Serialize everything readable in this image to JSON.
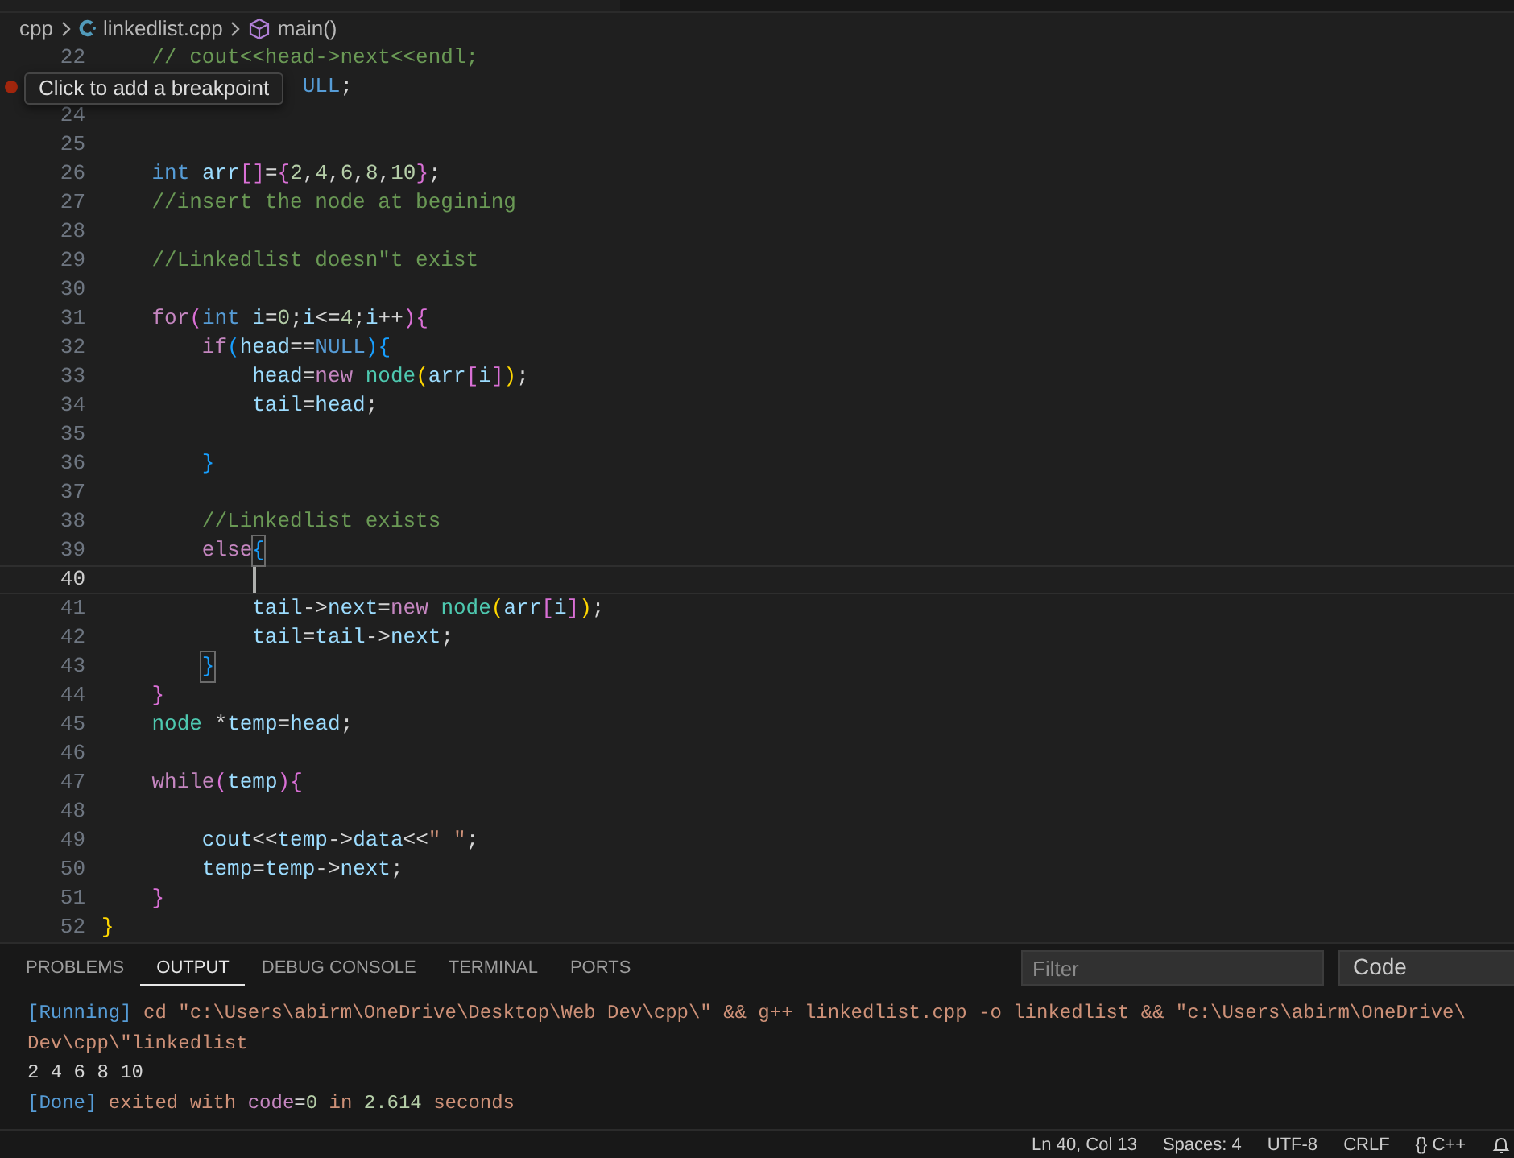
{
  "breadcrumb": {
    "folder": "cpp",
    "file": "linkedlist.cpp",
    "symbol": "main()"
  },
  "editor": {
    "tooltip": "Click to add a breakpoint",
    "lines": [
      {
        "number": "22",
        "current": false,
        "tokens": [
          {
            "text": "    // cout<<head->next<<endl;",
            "kind": "c"
          }
        ]
      },
      {
        "current": false,
        "breakpoint_hint": true,
        "tokens": [
          {
            "text": "                ULL",
            "kind": "m"
          },
          {
            "text": ";",
            "kind": "p"
          }
        ]
      },
      {
        "number": "24",
        "current": false
      },
      {
        "number": "25",
        "current": false
      },
      {
        "number": "26",
        "current": false,
        "tokens": [
          {
            "text": "    int",
            "kind": "t"
          },
          {
            "text": " arr",
            "kind": "v"
          },
          {
            "text": "[]",
            "kind": "b2"
          },
          {
            "text": "=",
            "kind": "p"
          },
          {
            "text": "{",
            "kind": "b2"
          },
          {
            "text": "2",
            "kind": "n"
          },
          {
            "text": ",",
            "kind": "p"
          },
          {
            "text": "4",
            "kind": "n"
          },
          {
            "text": ",",
            "kind": "p"
          },
          {
            "text": "6",
            "kind": "n"
          },
          {
            "text": ",",
            "kind": "p"
          },
          {
            "text": "8",
            "kind": "n"
          },
          {
            "text": ",",
            "kind": "p"
          },
          {
            "text": "10",
            "kind": "n"
          },
          {
            "text": "}",
            "kind": "b2"
          },
          {
            "text": ";",
            "kind": "p"
          }
        ]
      },
      {
        "number": "27",
        "current": false,
        "tokens": [
          {
            "text": "    //insert the node at begining",
            "kind": "c"
          }
        ]
      },
      {
        "number": "28",
        "current": false
      },
      {
        "number": "29",
        "current": false,
        "tokens": [
          {
            "text": "    //Linkedlist doesn\"t exist",
            "kind": "c"
          }
        ]
      },
      {
        "number": "30",
        "current": false
      },
      {
        "number": "31",
        "current": false,
        "tokens": [
          {
            "text": "    for",
            "kind": "k"
          },
          {
            "text": "(",
            "kind": "b2"
          },
          {
            "text": "int",
            "kind": "t"
          },
          {
            "text": " i",
            "kind": "v"
          },
          {
            "text": "=",
            "kind": "p"
          },
          {
            "text": "0",
            "kind": "n"
          },
          {
            "text": ";",
            "kind": "p"
          },
          {
            "text": "i",
            "kind": "v"
          },
          {
            "text": "<=",
            "kind": "p"
          },
          {
            "text": "4",
            "kind": "n"
          },
          {
            "text": ";",
            "kind": "p"
          },
          {
            "text": "i",
            "kind": "v"
          },
          {
            "text": "++",
            "kind": "p"
          },
          {
            "text": "){",
            "kind": "b2"
          }
        ]
      },
      {
        "number": "32",
        "current": false,
        "tokens": [
          {
            "text": "        if",
            "kind": "k"
          },
          {
            "text": "(",
            "kind": "b3"
          },
          {
            "text": "head",
            "kind": "v"
          },
          {
            "text": "==",
            "kind": "p"
          },
          {
            "text": "NULL",
            "kind": "m"
          },
          {
            "text": "){",
            "kind": "b3"
          }
        ]
      },
      {
        "number": "33",
        "current": false,
        "tokens": [
          {
            "text": "            head",
            "kind": "v"
          },
          {
            "text": "=",
            "kind": "p"
          },
          {
            "text": "new",
            "kind": "k"
          },
          {
            "text": " node",
            "kind": "f"
          },
          {
            "text": "(",
            "kind": "b1"
          },
          {
            "text": "arr",
            "kind": "v"
          },
          {
            "text": "[",
            "kind": "b2"
          },
          {
            "text": "i",
            "kind": "v"
          },
          {
            "text": "]",
            "kind": "b2"
          },
          {
            "text": ")",
            "kind": "b1"
          },
          {
            "text": ";",
            "kind": "p"
          }
        ]
      },
      {
        "number": "34",
        "current": false,
        "tokens": [
          {
            "text": "            tail",
            "kind": "v"
          },
          {
            "text": "=",
            "kind": "p"
          },
          {
            "text": "head",
            "kind": "v"
          },
          {
            "text": ";",
            "kind": "p"
          }
        ]
      },
      {
        "number": "35",
        "current": false
      },
      {
        "number": "36",
        "current": false,
        "tokens": [
          {
            "text": "        }",
            "kind": "b3"
          }
        ]
      },
      {
        "number": "37",
        "current": false
      },
      {
        "number": "38",
        "current": false,
        "tokens": [
          {
            "text": "        //Linkedlist exists",
            "kind": "c"
          }
        ]
      },
      {
        "number": "39",
        "current": false,
        "tokens": [
          {
            "text": "        else",
            "kind": "k"
          },
          {
            "text": "{",
            "kind": "b3",
            "matched": true
          }
        ]
      },
      {
        "number": "40",
        "current": true
      },
      {
        "number": "41",
        "current": false,
        "tokens": [
          {
            "text": "            tail",
            "kind": "v"
          },
          {
            "text": "->",
            "kind": "p"
          },
          {
            "text": "next",
            "kind": "v"
          },
          {
            "text": "=",
            "kind": "p"
          },
          {
            "text": "new",
            "kind": "k"
          },
          {
            "text": " node",
            "kind": "f"
          },
          {
            "text": "(",
            "kind": "b1"
          },
          {
            "text": "arr",
            "kind": "v"
          },
          {
            "text": "[",
            "kind": "b2"
          },
          {
            "text": "i",
            "kind": "v"
          },
          {
            "text": "]",
            "kind": "b2"
          },
          {
            "text": ")",
            "kind": "b1"
          },
          {
            "text": ";",
            "kind": "p"
          }
        ]
      },
      {
        "number": "42",
        "current": false,
        "tokens": [
          {
            "text": "            tail",
            "kind": "v"
          },
          {
            "text": "=",
            "kind": "p"
          },
          {
            "text": "tail",
            "kind": "v"
          },
          {
            "text": "->",
            "kind": "p"
          },
          {
            "text": "next",
            "kind": "v"
          },
          {
            "text": ";",
            "kind": "p"
          }
        ]
      },
      {
        "number": "43",
        "current": false,
        "tokens": [
          {
            "text": "        }",
            "kind": "b3",
            "matched": true
          }
        ]
      },
      {
        "number": "44",
        "current": false,
        "tokens": [
          {
            "text": "    }",
            "kind": "b2"
          }
        ]
      },
      {
        "number": "45",
        "current": false,
        "tokens": [
          {
            "text": "    node",
            "kind": "f"
          },
          {
            "text": " *",
            "kind": "p"
          },
          {
            "text": "temp",
            "kind": "v"
          },
          {
            "text": "=",
            "kind": "p"
          },
          {
            "text": "head",
            "kind": "v"
          },
          {
            "text": ";",
            "kind": "p"
          }
        ]
      },
      {
        "number": "46",
        "current": false
      },
      {
        "number": "47",
        "current": false,
        "tokens": [
          {
            "text": "    while",
            "kind": "k"
          },
          {
            "text": "(",
            "kind": "b2"
          },
          {
            "text": "temp",
            "kind": "v"
          },
          {
            "text": "){",
            "kind": "b2"
          }
        ]
      },
      {
        "number": "48",
        "current": false
      },
      {
        "number": "49",
        "current": false,
        "tokens": [
          {
            "text": "        cout",
            "kind": "v"
          },
          {
            "text": "<<",
            "kind": "p"
          },
          {
            "text": "temp",
            "kind": "v"
          },
          {
            "text": "->",
            "kind": "p"
          },
          {
            "text": "data",
            "kind": "v"
          },
          {
            "text": "<<",
            "kind": "p"
          },
          {
            "text": "\" \"",
            "kind": "s"
          },
          {
            "text": ";",
            "kind": "p"
          }
        ]
      },
      {
        "number": "50",
        "current": false,
        "tokens": [
          {
            "text": "        temp",
            "kind": "v"
          },
          {
            "text": "=",
            "kind": "p"
          },
          {
            "text": "temp",
            "kind": "v"
          },
          {
            "text": "->",
            "kind": "p"
          },
          {
            "text": "next",
            "kind": "v"
          },
          {
            "text": ";",
            "kind": "p"
          }
        ]
      },
      {
        "number": "51",
        "current": false,
        "tokens": [
          {
            "text": "    }",
            "kind": "b2"
          }
        ]
      },
      {
        "number": "52",
        "current": false,
        "tokens": [
          {
            "text": "}",
            "kind": "b1"
          }
        ]
      }
    ]
  },
  "panel": {
    "tabs": [
      {
        "label": "PROBLEMS",
        "selected": false
      },
      {
        "label": "OUTPUT",
        "selected": true
      },
      {
        "label": "DEBUG CONSOLE",
        "selected": false
      },
      {
        "label": "TERMINAL",
        "selected": false
      },
      {
        "label": "PORTS",
        "selected": false
      }
    ],
    "filter": {
      "placeholder": "Filter"
    },
    "channel": "Code",
    "output": [
      [
        {
          "text": "[Running]",
          "kind": "tag"
        },
        {
          "text": " cd \"c:\\Users\\abirm\\OneDrive\\Desktop\\Web Dev\\cpp\\\" && g++ linkedlist.cpp -o linkedlist && \"c:\\Users\\abirm\\OneDrive\\",
          "kind": "s"
        }
      ],
      [
        {
          "text": "Dev\\cpp\\\"linkedlist",
          "kind": "s"
        }
      ],
      [
        {
          "text": "2 4 6 8 10",
          "kind": "p"
        }
      ],
      [
        {
          "text": "[Done]",
          "kind": "tag"
        },
        {
          "text": " exited with ",
          "kind": "s"
        },
        {
          "text": "code",
          "kind": "k"
        },
        {
          "text": "=",
          "kind": "p"
        },
        {
          "text": "0",
          "kind": "n"
        },
        {
          "text": " in ",
          "kind": "s"
        },
        {
          "text": "2.614",
          "kind": "n"
        },
        {
          "text": " seconds",
          "kind": "s"
        }
      ]
    ]
  },
  "status_bar": [
    "Ln 40, Col 13",
    "Spaces: 4",
    "UTF-8",
    "CRLF",
    "{} C++"
  ]
}
